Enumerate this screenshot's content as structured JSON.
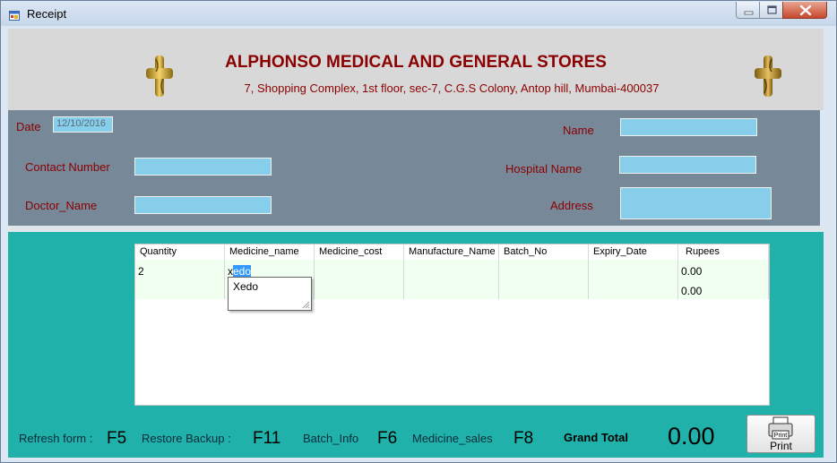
{
  "window": {
    "title": "Receipt"
  },
  "header": {
    "store_name": "ALPHONSO MEDICAL AND GENERAL STORES",
    "store_address": "7, Shopping Complex, 1st floor, sec-7, C.G.S Colony, Antop hill, Mumbai-400037"
  },
  "form": {
    "date_label": "Date",
    "date_value": "12/10/2016",
    "name_label": "Name",
    "name_value": "",
    "contact_label": "Contact Number",
    "contact_value": "",
    "hospital_label": "Hospital Name",
    "hospital_value": "",
    "doctor_label": "Doctor_Name",
    "doctor_value": "",
    "address_label": "Address",
    "address_value": ""
  },
  "grid": {
    "columns": [
      "Quantity",
      "Medicine_name",
      "Medicine_cost",
      "Manufacture_Name",
      "Batch_No",
      "Expiry_Date",
      "Rupees"
    ],
    "row": {
      "quantity": "2",
      "medicine_typed_prefix": "x",
      "medicine_selected_text": "edo",
      "medicine_cost": "",
      "manufacture_name": "",
      "batch_no": "",
      "expiry_date": "",
      "rupees_1": "0.00",
      "rupees_2": "0.00"
    },
    "autocomplete_suggestion": "Xedo"
  },
  "footer": {
    "refresh_label": "Refresh form :",
    "refresh_key": "F5",
    "restore_label": "Restore Backup :",
    "restore_key": "F11",
    "batch_label": "Batch_Info",
    "batch_key": "F6",
    "sales_label": "Medicine_sales",
    "sales_key": "F8",
    "grand_total_label": "Grand Total",
    "grand_total_value": "0.00",
    "print_label": "Print",
    "print_icon_text": "Print"
  },
  "colors": {
    "title_red": "#8b0000",
    "info_panel": "#778899",
    "lower_panel": "#20b2aa",
    "textbox": "#87ceeb"
  },
  "icons": {
    "window": "app-window-icon",
    "cross_left": "gold-cross-icon",
    "cross_right": "gold-cross-icon",
    "print": "printer-icon"
  }
}
